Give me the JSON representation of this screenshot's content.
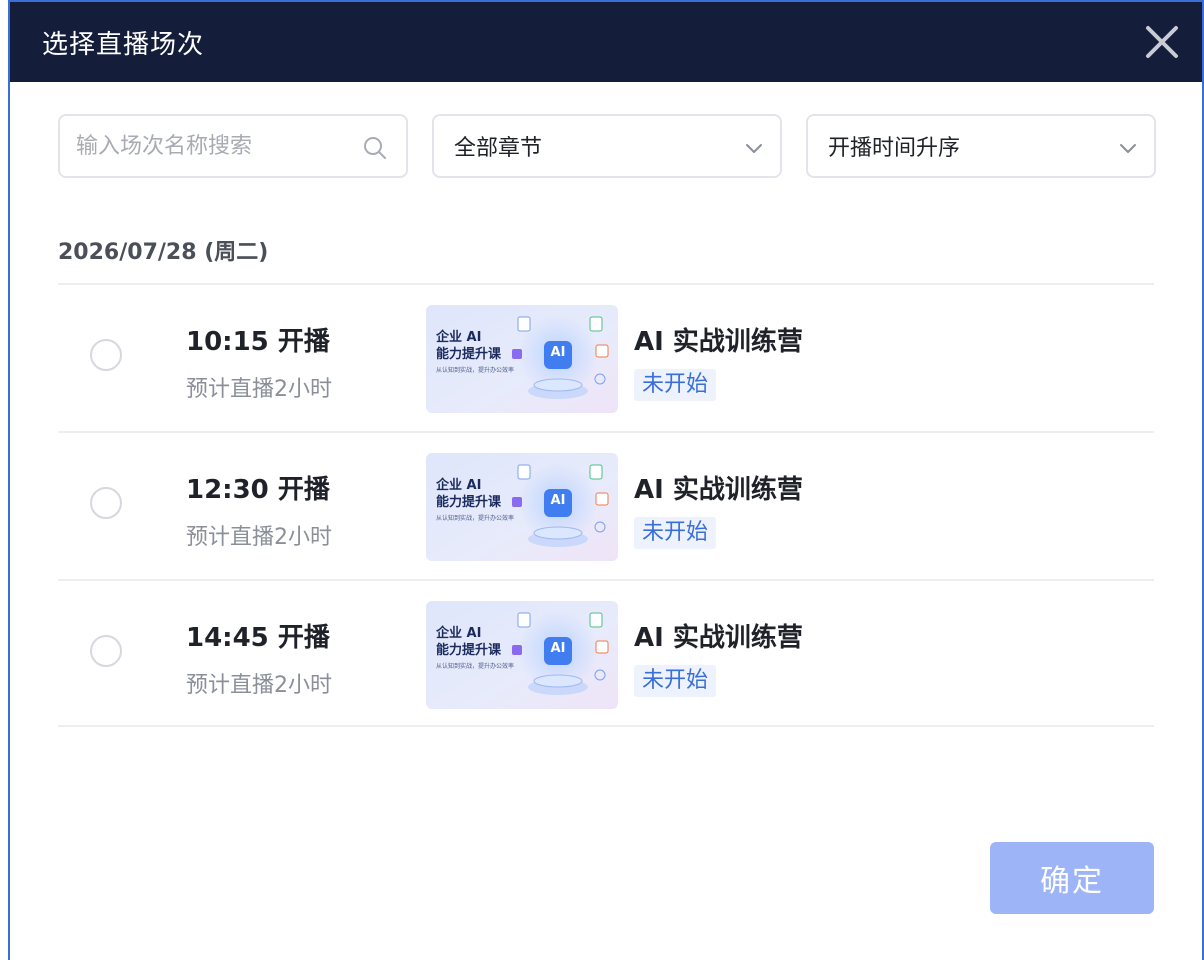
{
  "dialog": {
    "title": "选择直播场次",
    "close_icon": "close-icon"
  },
  "filters": {
    "search_placeholder": "输入场次名称搜索",
    "chapter_select": "全部章节",
    "sort_select": "开播时间升序"
  },
  "date_group": "2026/07/28 (周二)",
  "sessions": [
    {
      "time": "10:15 开播",
      "duration": "预计直播2小时",
      "title": "AI 实战训练营",
      "status": "未开始",
      "thumb_line1": "企业 AI",
      "thumb_line2": "能力提升课",
      "thumb_line3": "从认知到实战，提升办公效率"
    },
    {
      "time": "12:30 开播",
      "duration": "预计直播2小时",
      "title": "AI 实战训练营",
      "status": "未开始",
      "thumb_line1": "企业 AI",
      "thumb_line2": "能力提升课",
      "thumb_line3": "从认知到实战，提升办公效率"
    },
    {
      "time": "14:45 开播",
      "duration": "预计直播2小时",
      "title": "AI 实战训练营",
      "status": "未开始",
      "thumb_line1": "企业 AI",
      "thumb_line2": "能力提升课",
      "thumb_line3": "从认知到实战，提升办公效率"
    }
  ],
  "footer": {
    "confirm_label": "确定"
  },
  "colors": {
    "header_bg": "#141d3a",
    "accent": "#3a6fd8",
    "confirm_disabled": "#9db5f7",
    "status_bg": "#edf2fd"
  }
}
